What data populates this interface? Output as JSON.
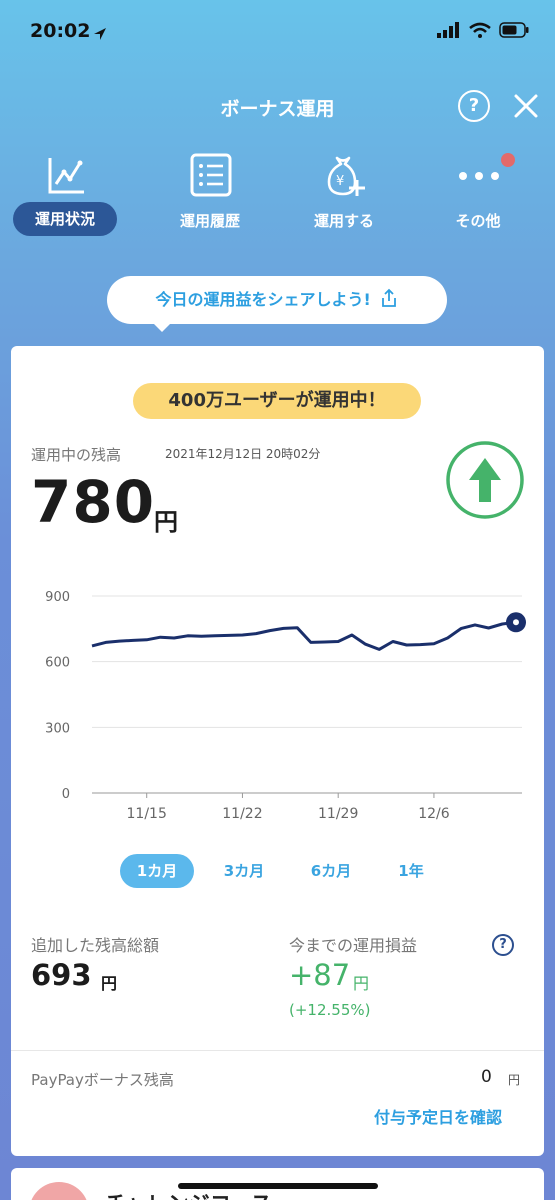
{
  "status_bar": {
    "time": "20:02"
  },
  "header": {
    "title": "ボーナス運用",
    "help_symbol": "?"
  },
  "nav": {
    "items": [
      {
        "label": "運用状況",
        "icon": "line-chart-icon",
        "active": true
      },
      {
        "label": "運用履歴",
        "icon": "list-icon",
        "active": false
      },
      {
        "label": "運用する",
        "icon": "money-bag-plus-icon",
        "active": false
      },
      {
        "label": "その他",
        "icon": "more-dots-icon",
        "active": false,
        "badge": true
      }
    ]
  },
  "share": {
    "label": "今日の運用益をシェアしよう!"
  },
  "summary": {
    "users_badge": "400万ユーザーが運用中！",
    "balance_label": "運用中の残高",
    "timestamp": "2021年12月12日 20時02分",
    "balance": "780",
    "unit": "円"
  },
  "chart_data": {
    "type": "line",
    "ylim": [
      0,
      900
    ],
    "yticks": [
      "900",
      "600",
      "300",
      "0"
    ],
    "xticks": [
      "11/15",
      "11/22",
      "11/29",
      "12/6"
    ],
    "series": [
      {
        "values": [
          672,
          688,
          694,
          697,
          700,
          712,
          708,
          718,
          716,
          718,
          720,
          722,
          728,
          742,
          752,
          755,
          688,
          690,
          692,
          722,
          680,
          656,
          692,
          676,
          678,
          682,
          708,
          752,
          768,
          754,
          772,
          780
        ]
      }
    ],
    "line_color": "#1a2f6b"
  },
  "period_tabs": [
    {
      "label": "1カ月",
      "active": true
    },
    {
      "label": "3カ月",
      "active": false
    },
    {
      "label": "6カ月",
      "active": false
    },
    {
      "label": "1年",
      "active": false
    }
  ],
  "stats": {
    "added_label": "追加した残高総額",
    "added_value": "693",
    "added_unit": "円",
    "gain_label": "今までの運用損益",
    "gain_value": "+87",
    "gain_unit": "円",
    "gain_pct": "(+12.55%)",
    "help_symbol": "?"
  },
  "paypay": {
    "label": "PayPayボーナス残高",
    "value": "0",
    "unit": "円",
    "link": "付与予定日を確認"
  },
  "next_card": {
    "title": "チャレンジコース"
  },
  "colors": {
    "accent": "#2d9fe0",
    "nav_active": "#2c5797",
    "gain": "#45b36a",
    "badge": "#fbd878"
  }
}
